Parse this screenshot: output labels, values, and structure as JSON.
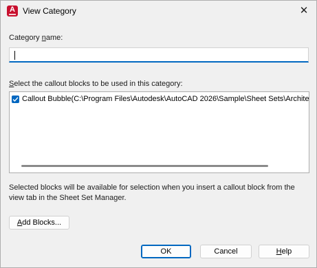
{
  "window": {
    "title": "View Category",
    "app_icon_letter": "A",
    "close_glyph": "✕"
  },
  "category": {
    "label_prefix": "Category ",
    "label_ul": "n",
    "label_suffix": "ame:",
    "value": ""
  },
  "callouts": {
    "label_ul": "S",
    "label_suffix": "elect the callout blocks to be used in this category:",
    "items": [
      {
        "checked": true,
        "text": "Callout Bubble(C:\\Program Files\\Autodesk\\AutoCAD 2026\\Sample\\Sheet Sets\\Architectu"
      }
    ]
  },
  "info_text": "Selected blocks will be available for selection when you insert a callout block from the view tab in the Sheet Set Manager.",
  "buttons": {
    "add_blocks_ul": "A",
    "add_blocks_suffix": "dd Blocks...",
    "ok": "OK",
    "cancel": "Cancel",
    "help_ul": "H",
    "help_suffix": "elp"
  },
  "colors": {
    "accent": "#0067c0",
    "autocad_red": "#c8102e"
  }
}
